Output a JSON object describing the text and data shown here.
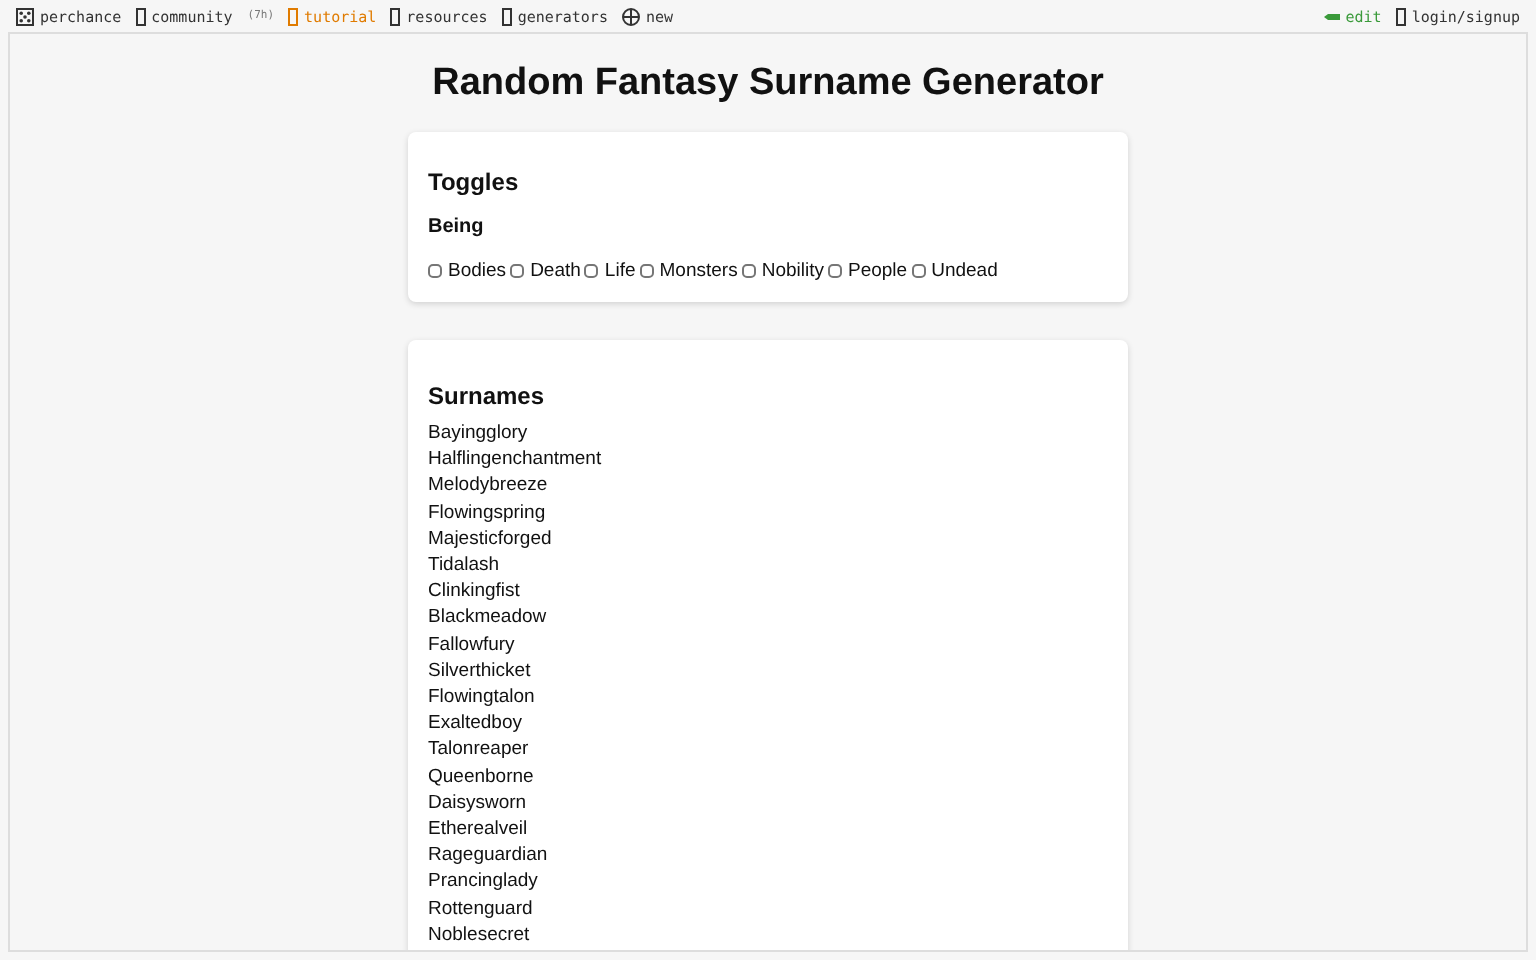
{
  "nav": {
    "left": [
      {
        "kind": "logo",
        "label": "perchance"
      },
      {
        "kind": "box",
        "label": "community",
        "badge": "(7h)"
      },
      {
        "kind": "highlight",
        "label": "tutorial"
      },
      {
        "kind": "box",
        "label": "resources"
      },
      {
        "kind": "box",
        "label": "generators"
      },
      {
        "kind": "globe",
        "label": "new"
      }
    ],
    "right": [
      {
        "kind": "pencil",
        "label": "edit"
      },
      {
        "kind": "box",
        "label": "login/signup"
      }
    ]
  },
  "title": "Random Fantasy Surname Generator",
  "toggles": {
    "heading": "Toggles",
    "group": "Being",
    "options": [
      {
        "label": "Bodies",
        "checked": false
      },
      {
        "label": "Death",
        "checked": false
      },
      {
        "label": "Life",
        "checked": false
      },
      {
        "label": "Monsters",
        "checked": false
      },
      {
        "label": "Nobility",
        "checked": false
      },
      {
        "label": "People",
        "checked": false
      },
      {
        "label": "Undead",
        "checked": false
      }
    ]
  },
  "surnames": {
    "heading": "Surnames",
    "items": [
      "Bayingglory",
      "Halflingenchantment",
      "Melodybreeze",
      "Flowingspring",
      "Majesticforged",
      "Tidalash",
      "Clinkingfist",
      "Blackmeadow",
      "Fallowfury",
      "Silverthicket",
      "Flowingtalon",
      "Exaltedboy",
      "Talonreaper",
      "Queenborne",
      "Daisysworn",
      "Etherealveil",
      "Rageguardian",
      "Prancinglady",
      "Rottenguard",
      "Noblesecret"
    ]
  }
}
